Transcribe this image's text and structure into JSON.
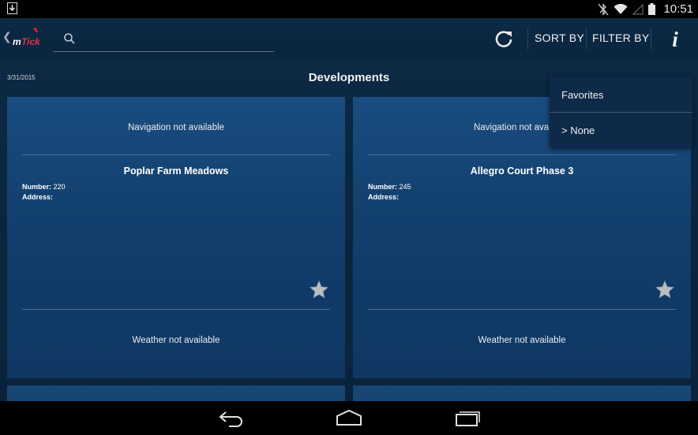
{
  "status_bar": {
    "time": "10:51"
  },
  "toolbar": {
    "logo_text": "mTick",
    "search_placeholder": "",
    "sort_label": "SORT BY",
    "filter_label": "FILTER BY"
  },
  "page": {
    "date": "3/31/2015",
    "title": "Developments"
  },
  "cards": [
    {
      "navigation_text": "Navigation not available",
      "name": "Poplar Farm Meadows",
      "number_label": "Number:",
      "number_value": "220",
      "address_label": "Address:",
      "address_value": "",
      "weather_text": "Weather not available"
    },
    {
      "navigation_text": "Navigation not available",
      "name": "Allegro Court Phase 3",
      "number_label": "Number:",
      "number_value": "245",
      "address_label": "Address:",
      "address_value": "",
      "weather_text": "Weather not available"
    }
  ],
  "filter_menu": {
    "items": [
      {
        "label": "Favorites"
      },
      {
        "label": "> None"
      }
    ]
  },
  "colors": {
    "card_top": "#1a4c80",
    "card_bottom": "#0f3963",
    "app_background": "#0b2640",
    "star": "#b9bcc0"
  },
  "icons": {
    "download": "download-icon",
    "bluetooth": "bluetooth-off-icon",
    "wifi": "wifi-icon",
    "signal": "signal-icon",
    "battery": "battery-icon",
    "search": "search-icon",
    "refresh": "refresh-icon",
    "info": "info-icon",
    "star": "star-icon",
    "back": "back-icon",
    "home": "home-icon",
    "recents": "recents-icon"
  }
}
